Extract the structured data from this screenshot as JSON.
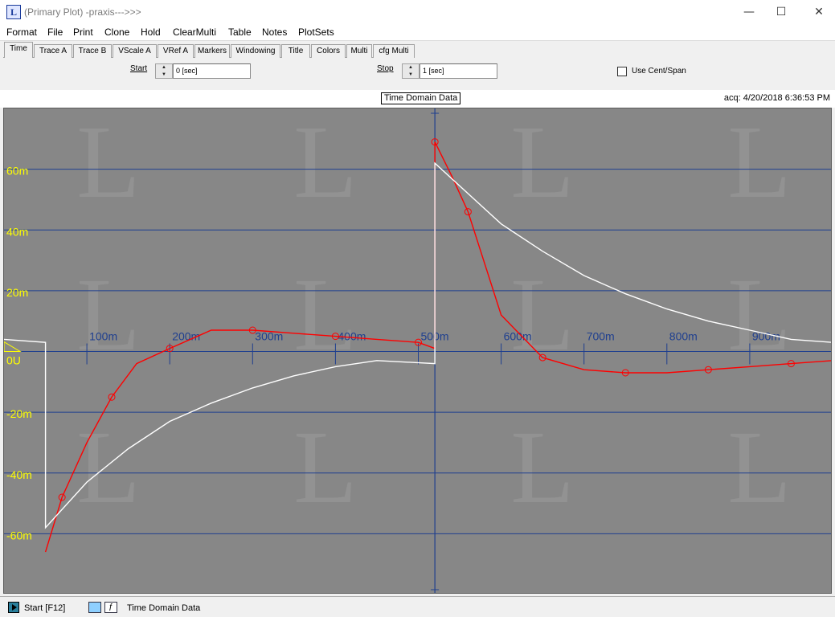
{
  "window": {
    "title": "(Primary Plot) -praxis--->>>",
    "icon_glyph": "L",
    "controls": {
      "minimize": "—",
      "maximize": "☐",
      "close": "✕"
    }
  },
  "menu": [
    "Format",
    "File",
    "Print",
    "Clone",
    "Hold",
    "ClearMulti",
    "Table",
    "Notes",
    "PlotSets"
  ],
  "tabs": [
    "Time",
    "Trace A",
    "Trace B",
    "VScale A",
    "VRef A",
    "Markers",
    "Windowing",
    "Title",
    "Colors",
    "Multi",
    "cfg Multi"
  ],
  "active_tab": "Time",
  "controls": {
    "start_label": "Start",
    "start_value": "0 [sec]",
    "stop_label": "Stop",
    "stop_value": "1 [sec]",
    "centspan_label": "Use Cent/Span",
    "centspan_checked": false
  },
  "plot": {
    "title": "Time Domain Data",
    "acq": "acq: 4/20/2018 6:36:53 PM",
    "background_color": "#878787",
    "grid_color": "#1f3f8f",
    "label_color": "#ffff00",
    "watermark_glyph": "L",
    "zero_label": "0U"
  },
  "chart_data": {
    "type": "line",
    "xlabel": "",
    "ylabel": "",
    "xlim": [
      0,
      1
    ],
    "ylim": [
      -80,
      80
    ],
    "x_tick_values": [
      0.1,
      0.2,
      0.3,
      0.4,
      0.5,
      0.6,
      0.7,
      0.8,
      0.9
    ],
    "x_tick_labels": [
      "100m",
      "200m",
      "300m",
      "400m",
      "500m",
      "600m",
      "700m",
      "800m",
      "900m"
    ],
    "y_tick_values": [
      60,
      40,
      20,
      -20,
      -40,
      -60
    ],
    "y_tick_labels": [
      "60m",
      "40m",
      "20m",
      "-20m",
      "-40m",
      "-60m"
    ],
    "grid": true,
    "series": [
      {
        "name": "",
        "color": "#ff0000",
        "markers": "circle",
        "x": [
          0.05,
          0.07,
          0.1,
          0.13,
          0.16,
          0.2,
          0.25,
          0.3,
          0.35,
          0.4,
          0.45,
          0.5,
          0.52,
          0.52,
          0.54,
          0.56,
          0.6,
          0.65,
          0.7,
          0.75,
          0.8,
          0.85,
          0.9,
          0.95,
          1.0
        ],
        "y": [
          -66,
          -48,
          -30,
          -15,
          -4,
          1,
          7,
          7,
          6,
          5,
          4,
          3,
          1,
          69,
          58,
          46,
          12,
          -2,
          -6,
          -7,
          -7,
          -6,
          -5,
          -4,
          -3
        ]
      },
      {
        "name": "",
        "color": "#ffffff",
        "markers": "none",
        "x": [
          0.0,
          0.05,
          0.05,
          0.1,
          0.15,
          0.2,
          0.25,
          0.3,
          0.35,
          0.4,
          0.45,
          0.52,
          0.52,
          0.6,
          0.65,
          0.7,
          0.75,
          0.8,
          0.85,
          0.9,
          0.95,
          1.0,
          1.0
        ],
        "y": [
          4,
          3,
          -58,
          -43,
          -32,
          -23,
          -17,
          -12,
          -8,
          -5,
          -3,
          -4,
          62,
          42,
          33,
          25,
          19,
          14,
          10,
          7,
          4,
          3,
          -58
        ]
      }
    ]
  },
  "status": {
    "start_label": "Start [F12]",
    "icon1": "plot-icon",
    "icon2_glyph": "ƒ",
    "right_text": "Time Domain Data"
  }
}
